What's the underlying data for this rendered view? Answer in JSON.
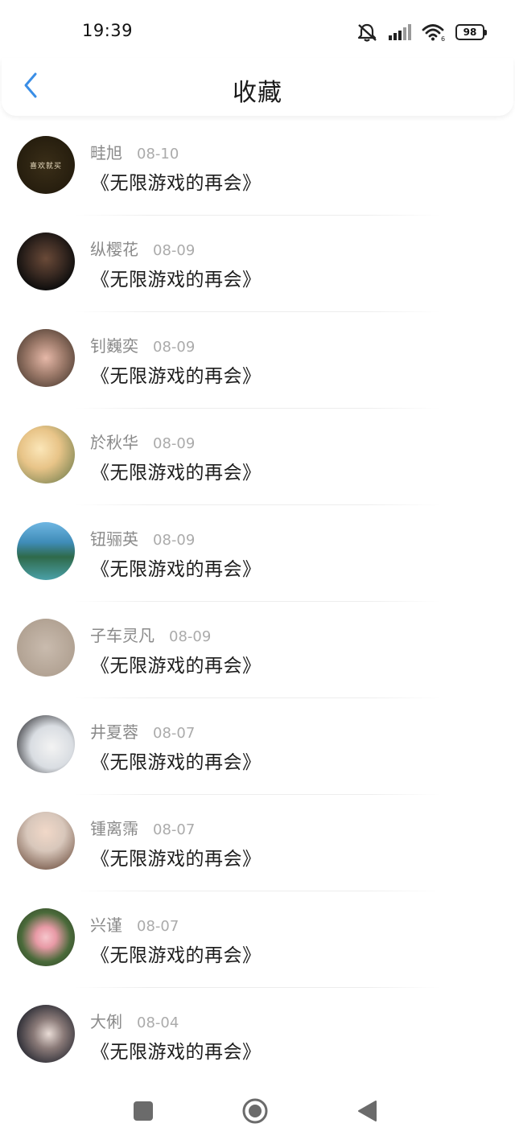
{
  "status_bar": {
    "time": "19:39",
    "battery": "98",
    "icons": [
      "bell-muted-icon",
      "signal-icon",
      "wifi-icon",
      "battery-icon"
    ]
  },
  "header": {
    "title": "收藏",
    "back_icon": "chevron-left-icon",
    "accent_color": "#3a8ee6"
  },
  "items": [
    {
      "name": "畦旭",
      "date": "08-10",
      "title": "《无限游戏的再会》",
      "avatar_text": "喜欢就买",
      "avatar_bg": "#2a2110"
    },
    {
      "name": "纵樱花",
      "date": "08-09",
      "title": "《无限游戏的再会》",
      "avatar_text": "",
      "avatar_bg": "#3a2a22"
    },
    {
      "name": "钊巍奕",
      "date": "08-09",
      "title": "《无限游戏的再会》",
      "avatar_text": "",
      "avatar_bg": "#8a6a5a"
    },
    {
      "name": "於秋华",
      "date": "08-09",
      "title": "《无限游戏的再会》",
      "avatar_text": "",
      "avatar_bg": "#e8c488"
    },
    {
      "name": "钮骊英",
      "date": "08-09",
      "title": "《无限游戏的再会》",
      "avatar_text": "",
      "avatar_bg": "#3f8cb8"
    },
    {
      "name": "子车灵凡",
      "date": "08-09",
      "title": "《无限游戏的再会》",
      "avatar_text": "",
      "avatar_bg": "#b8a89a"
    },
    {
      "name": "井夏蓉",
      "date": "08-07",
      "title": "《无限游戏的再会》",
      "avatar_text": "",
      "avatar_bg": "#d9dde2"
    },
    {
      "name": "锺离霈",
      "date": "08-07",
      "title": "《无限游戏的再会》",
      "avatar_text": "",
      "avatar_bg": "#d8c7bb"
    },
    {
      "name": "兴谨",
      "date": "08-07",
      "title": "《无限游戏的再会》",
      "avatar_text": "",
      "avatar_bg": "#4a6a3a"
    },
    {
      "name": "大俐",
      "date": "08-04",
      "title": "《无限游戏的再会》",
      "avatar_text": "",
      "avatar_bg": "#303038"
    }
  ],
  "nav_bar": {
    "icons": [
      "recent-apps-icon",
      "home-icon",
      "back-icon"
    ]
  }
}
